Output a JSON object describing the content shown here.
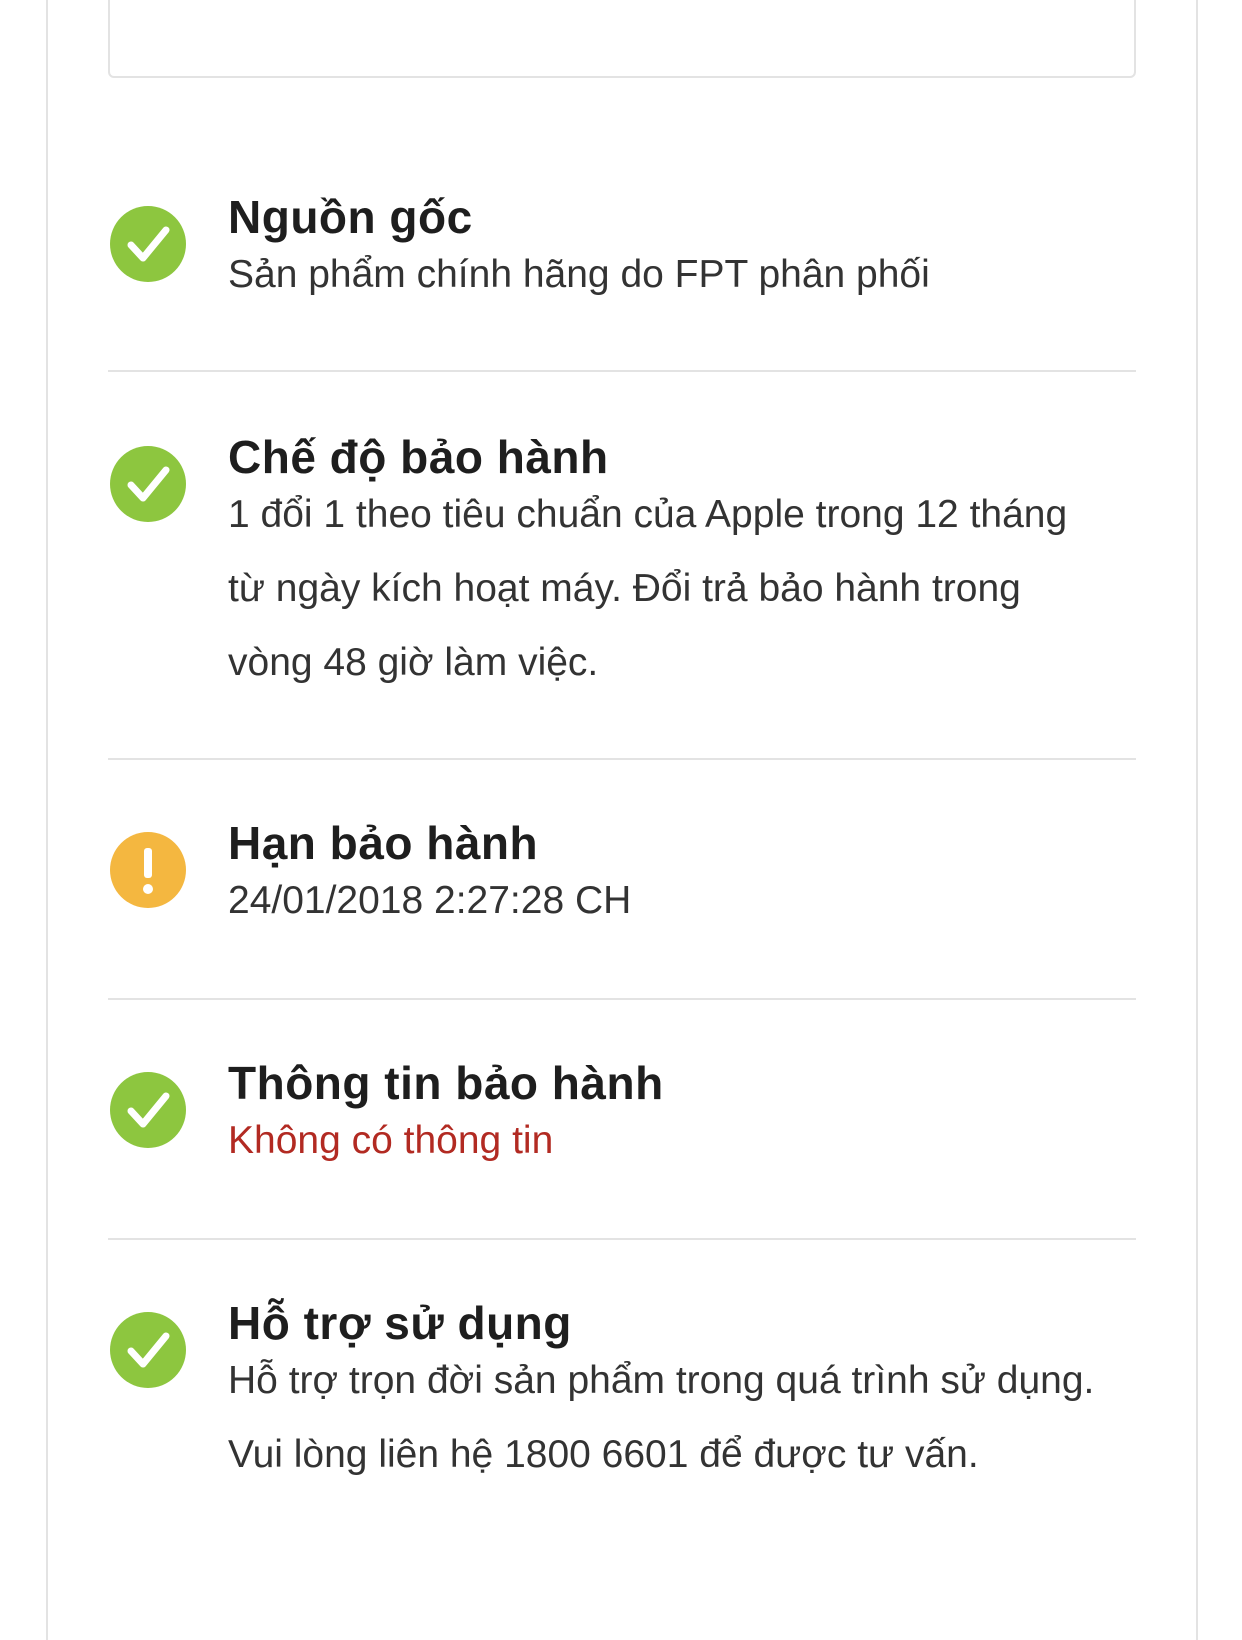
{
  "items": [
    {
      "status_icon": "check-circle-icon",
      "status": "ok",
      "title": "Nguồn gốc",
      "description": "Sản phẩm chính hãng do FPT phân phối"
    },
    {
      "status_icon": "check-circle-icon",
      "status": "ok",
      "title": "Chế độ bảo hành",
      "description": "1 đổi 1 theo tiêu chuẩn của Apple trong 12 tháng từ ngày kích hoạt máy. Đổi trả bảo hành trong vòng 48 giờ làm việc."
    },
    {
      "status_icon": "exclamation-circle-icon",
      "status": "warning",
      "title": "Hạn bảo hành",
      "description": "24/01/2018 2:27:28 CH"
    },
    {
      "status_icon": "check-circle-icon",
      "status": "ok",
      "title": "Thông tin bảo hành",
      "description": "Không có thông tin",
      "description_color": "#b22a22"
    },
    {
      "status_icon": "check-circle-icon",
      "status": "ok",
      "title": "Hỗ trợ sử dụng",
      "description": "Hỗ trợ trọn đời sản phẩm trong quá trình sử dụng. Vui lòng liên hệ 1800 6601 để được tư vấn."
    }
  ],
  "colors": {
    "ok": "#8dc63f",
    "warning": "#f4b740",
    "danger_text": "#b22a22",
    "divider": "#e3e3e3"
  }
}
